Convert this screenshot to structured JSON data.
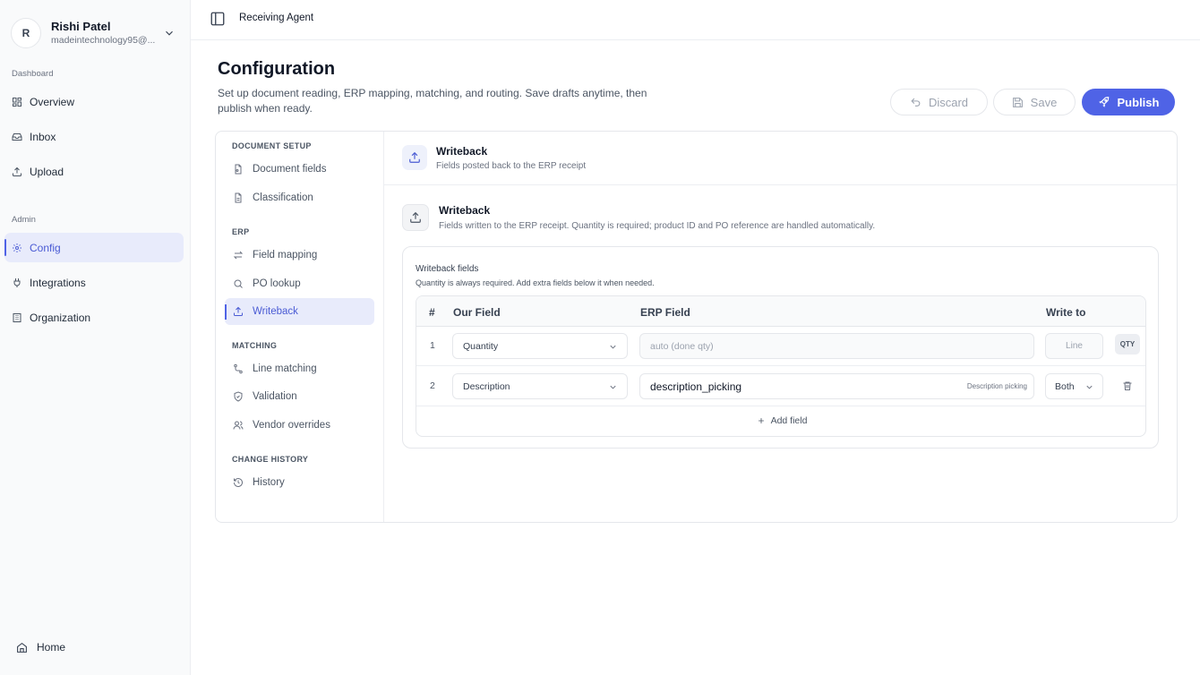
{
  "user": {
    "initial": "R",
    "name": "Rishi Patel",
    "email": "madeintechnology95@..."
  },
  "sidebar": {
    "sections": [
      "Dashboard",
      "Admin"
    ],
    "items": [
      {
        "label": "Overview",
        "icon": "grid-icon"
      },
      {
        "label": "Inbox",
        "icon": "inbox-icon"
      },
      {
        "label": "Upload",
        "icon": "upload-icon"
      },
      {
        "label": "Config",
        "icon": "gear-icon",
        "active": true
      },
      {
        "label": "Integrations",
        "icon": "plug-icon"
      },
      {
        "label": "Organization",
        "icon": "building-icon"
      }
    ],
    "home": "Home"
  },
  "topbar": {
    "breadcrumb": "Receiving Agent"
  },
  "header": {
    "title": "Configuration",
    "description": "Set up document reading, ERP mapping, matching, and routing. Save drafts anytime, then publish when ready.",
    "discard": "Discard",
    "save": "Save",
    "publish": "Publish"
  },
  "subnav": {
    "sections": [
      "DOCUMENT SETUP",
      "ERP",
      "MATCHING",
      "CHANGE HISTORY"
    ],
    "items": [
      {
        "label": "Document fields",
        "icon": "file-icon"
      },
      {
        "label": "Classification",
        "icon": "document-icon"
      },
      {
        "label": "Field mapping",
        "icon": "arrows-icon"
      },
      {
        "label": "PO lookup",
        "icon": "search-icon"
      },
      {
        "label": "Writeback",
        "icon": "upload-icon",
        "active": true
      },
      {
        "label": "Line matching",
        "icon": "route-icon"
      },
      {
        "label": "Validation",
        "icon": "shield-icon"
      },
      {
        "label": "Vendor overrides",
        "icon": "users-icon"
      },
      {
        "label": "History",
        "icon": "history-icon"
      }
    ]
  },
  "content": {
    "head_title": "Writeback",
    "head_sub": "Fields posted back to the ERP receipt",
    "section_title": "Writeback",
    "section_sub": "Fields written to the ERP receipt. Quantity is required; product ID and PO reference are handled automatically.",
    "box_label": "Writeback fields",
    "box_hint": "Quantity is always required. Add extra fields below it when needed.",
    "columns": [
      "#",
      "Our Field",
      "ERP Field",
      "Write to"
    ],
    "rows": [
      {
        "num": "1",
        "field": "Quantity",
        "erp": "auto (done qty)",
        "write_to": "Line",
        "badge": "QTY"
      },
      {
        "num": "2",
        "field": "Description",
        "erp": "description_picking",
        "erp_hint": "Description picking",
        "write_to": "Both"
      }
    ],
    "add_field": "Add field"
  }
}
